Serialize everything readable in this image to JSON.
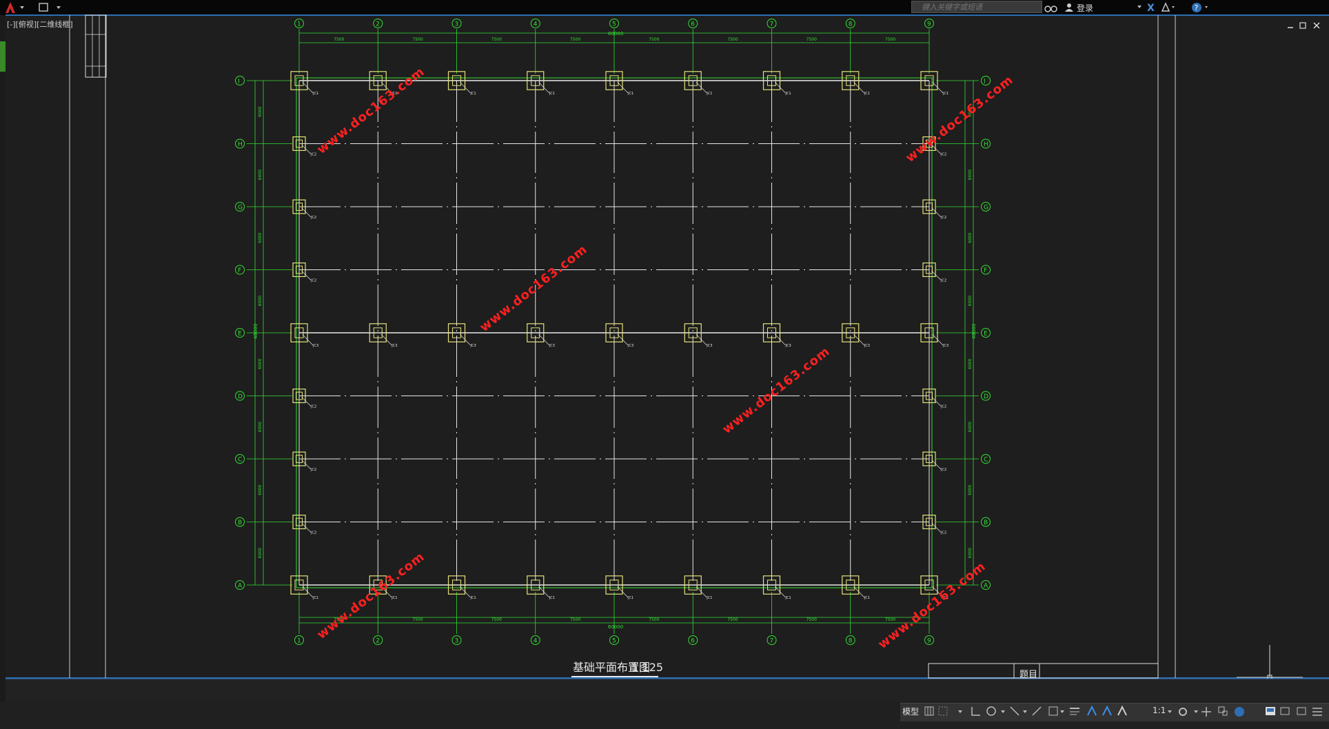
{
  "titlebar": {
    "search_placeholder": "键入关键字或短语",
    "login_label": "登录"
  },
  "viewport": {
    "label": "[-][俯视][二维线框]"
  },
  "drawing": {
    "title": "基础平面布置图",
    "scale": "1:125",
    "title_block_label": "题目",
    "column_axes": [
      "1",
      "2",
      "3",
      "4",
      "5",
      "6",
      "7",
      "8",
      "9"
    ],
    "row_axes": [
      "I",
      "H",
      "G",
      "F",
      "E",
      "D",
      "C",
      "B",
      "A"
    ],
    "bay_dims": [
      "7500",
      "7500",
      "7500",
      "7500",
      "7500",
      "7500",
      "7500",
      "7500"
    ],
    "total_length": "60000",
    "row_spacing": [
      "6000",
      "6000",
      "6000",
      "6000",
      "6000",
      "6000",
      "6000",
      "6000"
    ],
    "total_width": "48000",
    "footing_labels": {
      "corner": "JC1",
      "side": "JC2",
      "mid": "JC3"
    },
    "watermark": "www.doc163.com"
  },
  "statusbar": {
    "model_tab": "模型",
    "scale": "1:1"
  },
  "colors": {
    "background": "#1e1e1e",
    "axis_green": "#33e033",
    "footing_yellow": "#e6e37a",
    "grid_white": "#e8e8e8",
    "watermark_red": "#ff2020",
    "accent_blue": "#2e6fb4"
  }
}
